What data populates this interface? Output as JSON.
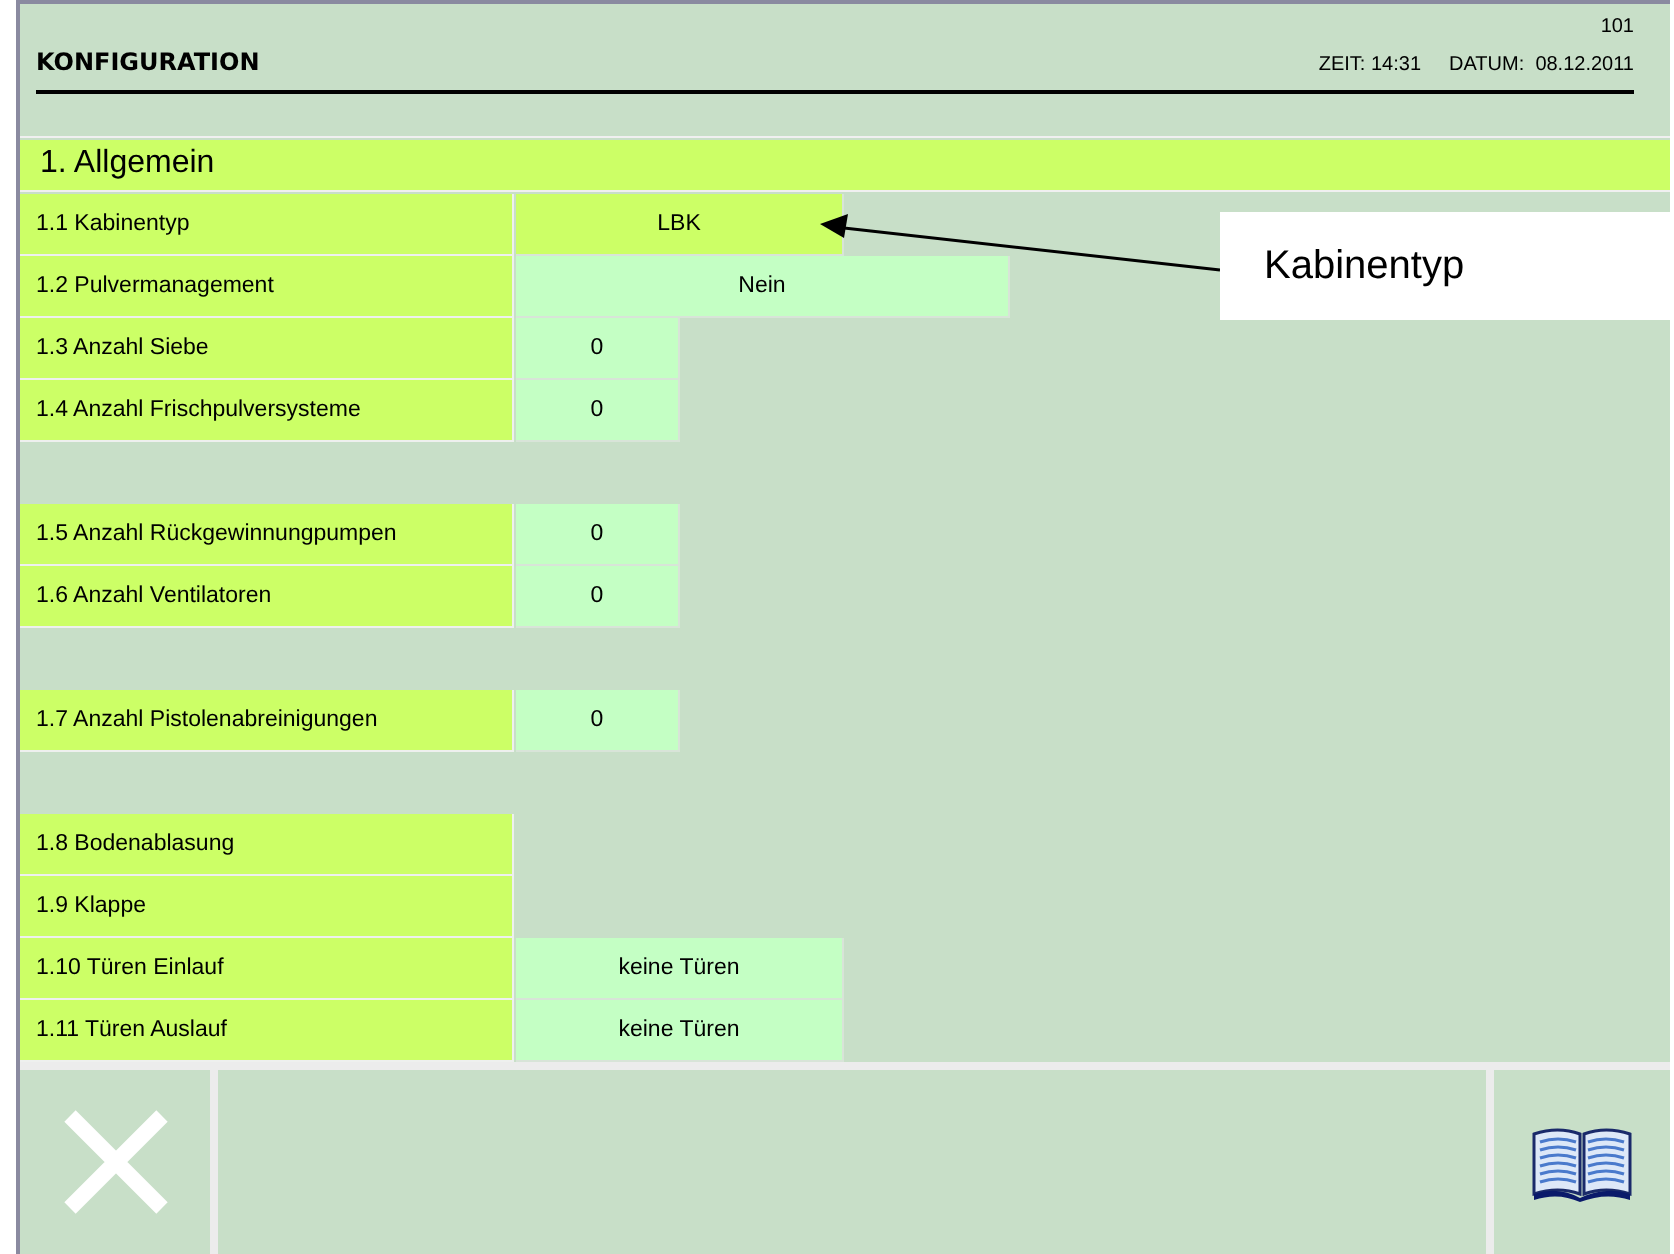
{
  "header": {
    "title": "KONFIGURATION",
    "page_number": "101",
    "time_label": "ZEIT:",
    "time": "14:31",
    "date_label": "DATUM:",
    "date": "08.12.2011"
  },
  "section": {
    "title": "1. Allgemein"
  },
  "groups": [
    {
      "rows": [
        {
          "label": "1.1 Kabinentyp",
          "value": {
            "text": "LBK",
            "kind": "select",
            "selected": true
          }
        },
        {
          "label": "1.2 Pulvermanagement",
          "value": {
            "text": "Nein",
            "kind": "wide",
            "selected": false
          }
        },
        {
          "label": "1.3 Anzahl Siebe",
          "value": {
            "text": "0",
            "kind": "count",
            "selected": false
          }
        },
        {
          "label": "1.4 Anzahl Frischpulversysteme",
          "value": {
            "text": "0",
            "kind": "count",
            "selected": false
          }
        }
      ]
    },
    {
      "rows": [
        {
          "label": "1.5 Anzahl Rückgewinnungpumpen",
          "value": {
            "text": "0",
            "kind": "count",
            "selected": false
          }
        },
        {
          "label": "1.6 Anzahl Ventilatoren",
          "value": {
            "text": "0",
            "kind": "count",
            "selected": false
          }
        }
      ]
    },
    {
      "rows": [
        {
          "label": "1.7 Anzahl Pistolenabreinigungen",
          "value": {
            "text": "0",
            "kind": "count",
            "selected": false
          }
        }
      ]
    },
    {
      "rows": [
        {
          "label": "1.8 Bodenablasung"
        },
        {
          "label": "1.9 Klappe"
        },
        {
          "label": "1.10 Türen Einlauf",
          "value": {
            "text": "keine Türen",
            "kind": "select",
            "selected": false
          }
        },
        {
          "label": "1.11 Türen Auslauf",
          "value": {
            "text": "keine Türen",
            "kind": "select",
            "selected": false
          }
        }
      ]
    }
  ],
  "callout": {
    "text": "Kabinentyp"
  }
}
